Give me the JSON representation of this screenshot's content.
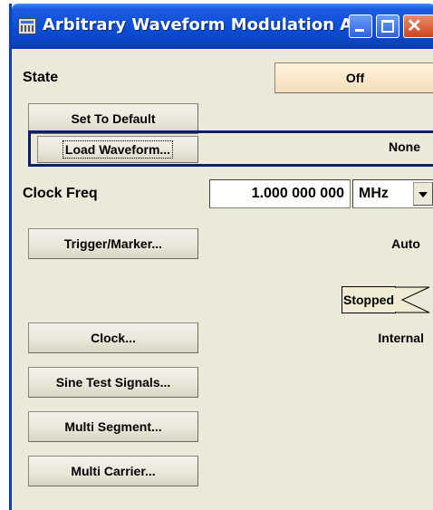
{
  "window": {
    "title": "Arbitrary Waveform Modulation  A",
    "icon": "signal-generator-icon",
    "controls": [
      "minimize-icon",
      "maximize-icon",
      "close-icon"
    ],
    "accent": "#0c4fd8",
    "focus_color": "#0c1f6e"
  },
  "state": {
    "label": "State",
    "value": "Off"
  },
  "set_default": {
    "label": "Set To Default"
  },
  "load_waveform": {
    "label": "Load Waveform...",
    "value": "None"
  },
  "clock_freq": {
    "label": "Clock Freq",
    "value": "1.000 000 000",
    "unit": "MHz"
  },
  "trigger_marker": {
    "label": "Trigger/Marker...",
    "value": "Auto",
    "status": "Stopped"
  },
  "clock": {
    "label": "Clock...",
    "value": "Internal"
  },
  "sine_test": {
    "label": "Sine Test Signals..."
  },
  "multi_segment": {
    "label": "Multi Segment..."
  },
  "multi_carrier": {
    "label": "Multi Carrier..."
  }
}
